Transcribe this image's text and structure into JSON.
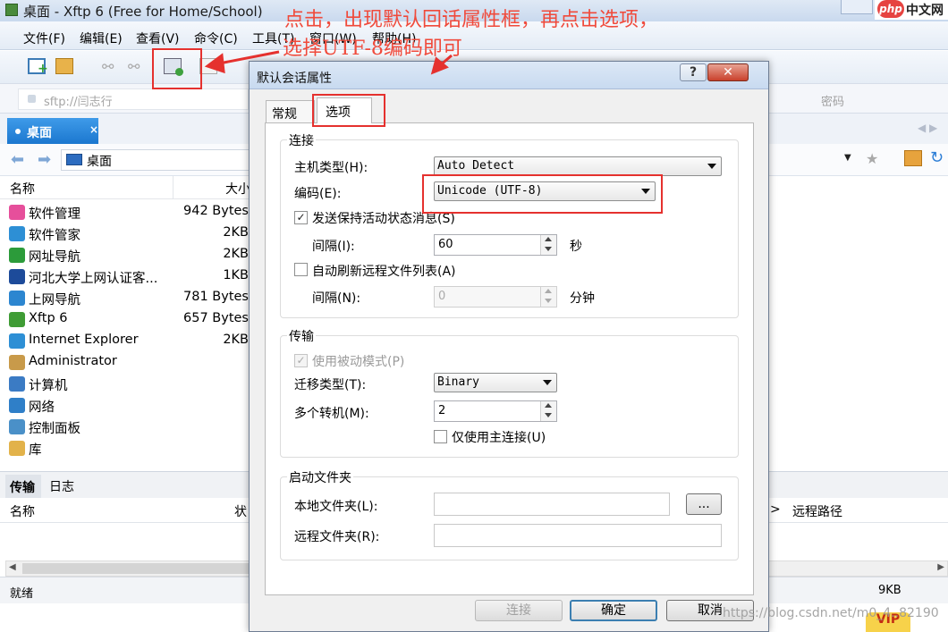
{
  "window": {
    "title": "桌面 - Xftp 6 (Free for Home/School)"
  },
  "watermark": {
    "site_badge": "php",
    "site_name": "中文网",
    "url": "https://blog.csdn.net/m0_4..82190",
    "vip": "VIP"
  },
  "menu": [
    {
      "label": "文件(F)"
    },
    {
      "label": "编辑(E)"
    },
    {
      "label": "查看(V)"
    },
    {
      "label": "命令(C)"
    },
    {
      "label": "工具(T)"
    },
    {
      "label": "窗口(W)"
    },
    {
      "label": "帮助(H)"
    }
  ],
  "address": {
    "value": "sftp://闫志行",
    "password_placeholder": "密码"
  },
  "tab": {
    "label": "桌面",
    "close": "×"
  },
  "nav": {
    "path": "桌面"
  },
  "files": {
    "col_name": "名称",
    "col_size": "大小",
    "rows": [
      {
        "name": "软件管理",
        "size": "942 Bytes",
        "color": "#e64f9b"
      },
      {
        "name": "软件管家",
        "size": "2KB",
        "color": "#2d8fd5"
      },
      {
        "name": "网址导航",
        "size": "2KB",
        "color": "#2c9b3a"
      },
      {
        "name": "河北大学上网认证客...",
        "size": "1KB",
        "color": "#1d4b9a"
      },
      {
        "name": "上网导航",
        "size": "781 Bytes",
        "color": "#2c86d0"
      },
      {
        "name": "Xftp 6",
        "size": "657 Bytes",
        "color": "#3f9c35"
      },
      {
        "name": "Internet Explorer",
        "size": "2KB",
        "color": "#2d8fd5"
      },
      {
        "name": "Administrator",
        "size": "",
        "color": "#c89a4a"
      },
      {
        "name": "计算机",
        "size": "",
        "color": "#3b7bc4"
      },
      {
        "name": "网络",
        "size": "",
        "color": "#2f7fc8"
      },
      {
        "name": "控制面板",
        "size": "",
        "color": "#4a90c8"
      },
      {
        "name": "库",
        "size": "",
        "color": "#e2b24a"
      }
    ]
  },
  "log": {
    "tab_transfer": "传输",
    "tab_log": "日志",
    "col_name": "名称",
    "col_state": "状",
    "col_gt": ">",
    "col_remote": "远程路径"
  },
  "status": {
    "ready": "就绪",
    "size": "9KB"
  },
  "dialog": {
    "title": "默认会话属性",
    "help": "?",
    "close": "✕",
    "tabs": {
      "general": "常规",
      "options": "选项"
    },
    "connection": {
      "group": "连接",
      "host_type_label": "主机类型(H):",
      "host_type_value": "Auto Detect",
      "encoding_label": "编码(E):",
      "encoding_value": "Unicode (UTF-8)",
      "keepalive_label": "发送保持活动状态消息(S)",
      "keepalive_checked": "✓",
      "interval_label": "间隔(I):",
      "interval_value": "60",
      "interval_unit": "秒",
      "auto_refresh_label": "自动刷新远程文件列表(A)",
      "refresh_interval_label": "间隔(N):",
      "refresh_interval_value": "0",
      "refresh_interval_unit": "分钟"
    },
    "transfer": {
      "group": "传输",
      "passive_label": "使用被动模式(P)",
      "passive_checked": "✓",
      "transfer_type_label": "迁移类型(T):",
      "transfer_type_value": "Binary",
      "multi_label": "多个转机(M):",
      "multi_value": "2",
      "main_only_label": "仅使用主连接(U)"
    },
    "startup": {
      "group": "启动文件夹",
      "local_label": "本地文件夹(L):",
      "browse": "...",
      "remote_label": "远程文件夹(R):"
    },
    "buttons": {
      "connect": "连接",
      "ok": "确定",
      "cancel": "取消"
    }
  },
  "annotation": {
    "line1": "点击，出现默认回话属性框，再点击选项，",
    "line2": "选择UTF-8编码即可",
    "color": "#e5312e"
  }
}
